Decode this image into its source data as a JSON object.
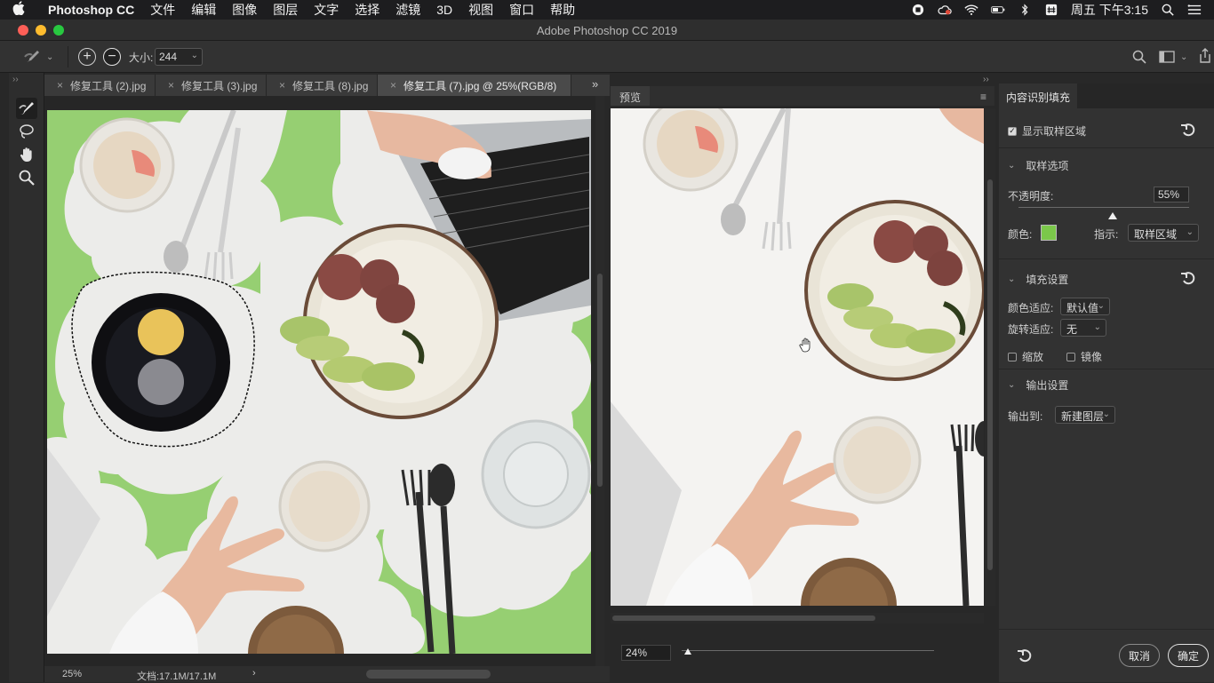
{
  "menubar": {
    "app_name": "Photoshop CC",
    "items": [
      "文件",
      "编辑",
      "图像",
      "图层",
      "文字",
      "选择",
      "滤镜",
      "3D",
      "视图",
      "窗口",
      "帮助"
    ],
    "clock": "周五 下午3:15"
  },
  "window": {
    "title": "Adobe Photoshop CC 2019"
  },
  "options_bar": {
    "size_label": "大小:",
    "size_value": "244"
  },
  "doc_tabs": [
    {
      "label": "修复工具 (2).jpg"
    },
    {
      "label": "修复工具 (3).jpg"
    },
    {
      "label": "修复工具 (8).jpg"
    },
    {
      "label": "修复工具 (7).jpg @ 25%(RGB/8)"
    }
  ],
  "status": {
    "zoom": "25%",
    "doc_info": "文档:17.1M/17.1M"
  },
  "preview": {
    "tab_label": "预览",
    "zoom_value": "24%"
  },
  "caf_panel": {
    "title": "内容识别填充",
    "show_sampling_area": "显示取样区域",
    "sampling_options": "取样选项",
    "opacity_label": "不透明度:",
    "opacity_value": "55%",
    "color_label": "颜色:",
    "color_value": "#7bc84a",
    "indicate_label": "指示:",
    "indicate_value": "取样区域",
    "fill_settings": "填充设置",
    "color_adapt_label": "颜色适应:",
    "color_adapt_value": "默认值",
    "rotation_adapt_label": "旋转适应:",
    "rotation_adapt_value": "无",
    "scale_label": "缩放",
    "mirror_label": "镜像",
    "output_settings": "输出设置",
    "output_to_label": "输出到:",
    "output_to_value": "新建图层",
    "cancel_label": "取消",
    "ok_label": "确定"
  }
}
